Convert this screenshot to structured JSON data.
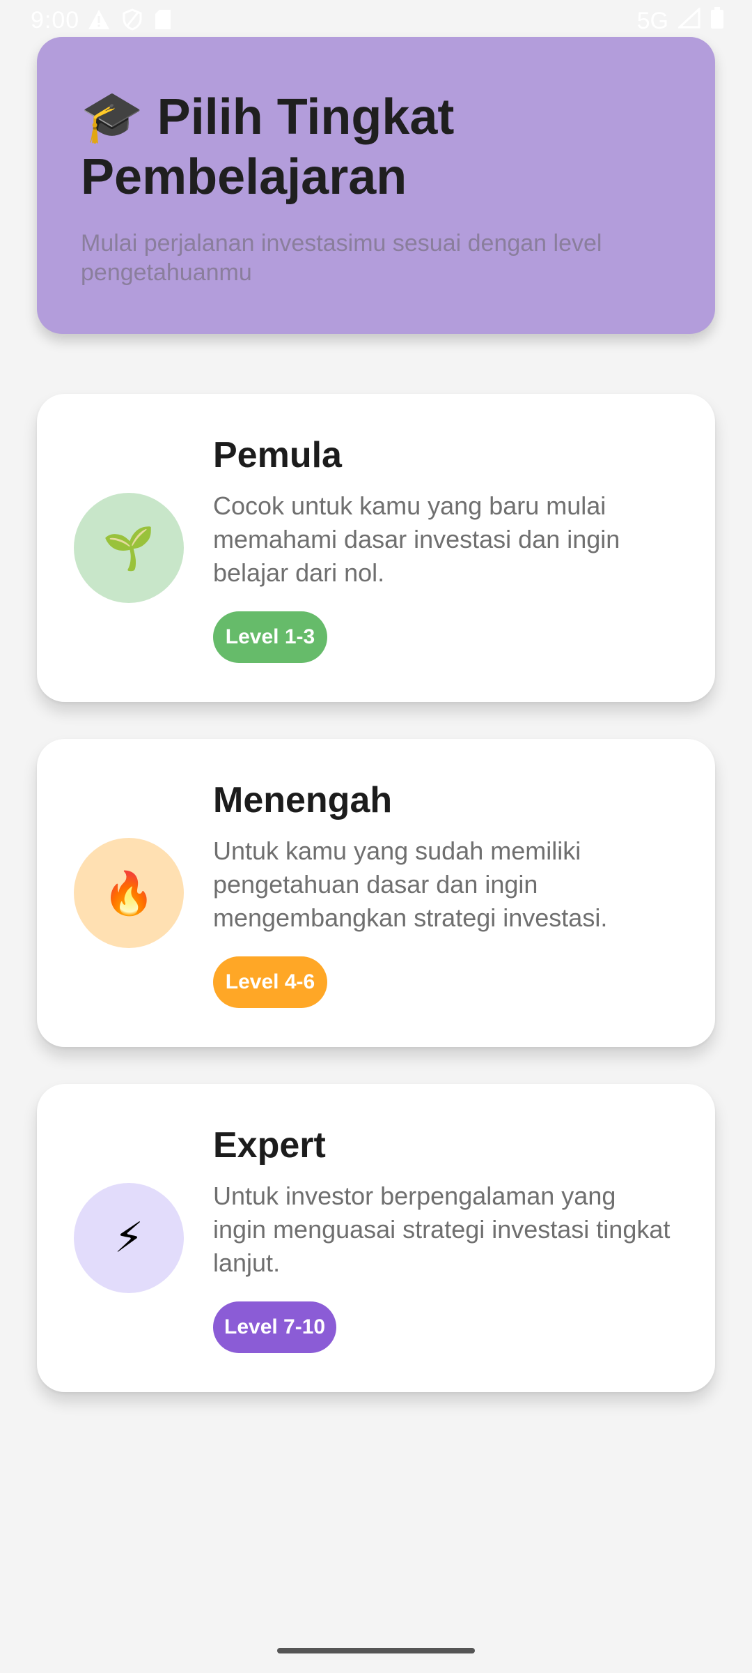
{
  "status_bar": {
    "time": "9:00",
    "network": "5G",
    "left_icons": [
      "warning-icon",
      "shield-icon",
      "sim-card-icon"
    ],
    "right_icons": [
      "signal-icon",
      "battery-icon"
    ]
  },
  "header": {
    "emoji": "🎓",
    "title": "Pilih Tingkat Pembelajaran",
    "subtitle": "Mulai perjalanan investasimu sesuai dengan level pengetahuanmu",
    "background": "#b39ddb"
  },
  "levels": [
    {
      "icon": "🌱",
      "icon_name": "seedling-icon",
      "title": "Pemula",
      "description": "Cocok untuk kamu yang baru mulai memahami dasar investasi dan ingin belajar dari nol.",
      "badge": "Level 1-3",
      "badge_color": "#66bb6a",
      "circle_color": "#c8e6c9"
    },
    {
      "icon": "🔥",
      "icon_name": "fire-icon",
      "title": "Menengah",
      "description": "Untuk kamu yang sudah memiliki pengetahuan dasar dan ingin mengembangkan strategi investasi.",
      "badge": "Level 4-6",
      "badge_color": "#ffa726",
      "circle_color": "#ffe0b2"
    },
    {
      "icon": "⚡",
      "icon_name": "lightning-icon",
      "title": "Expert",
      "description": "Untuk investor berpengalaman yang ingin menguasai strategi investasi tingkat lanjut.",
      "badge": "Level 7-10",
      "badge_color": "#8b5cd6",
      "circle_color": "#e2dcfb"
    }
  ]
}
